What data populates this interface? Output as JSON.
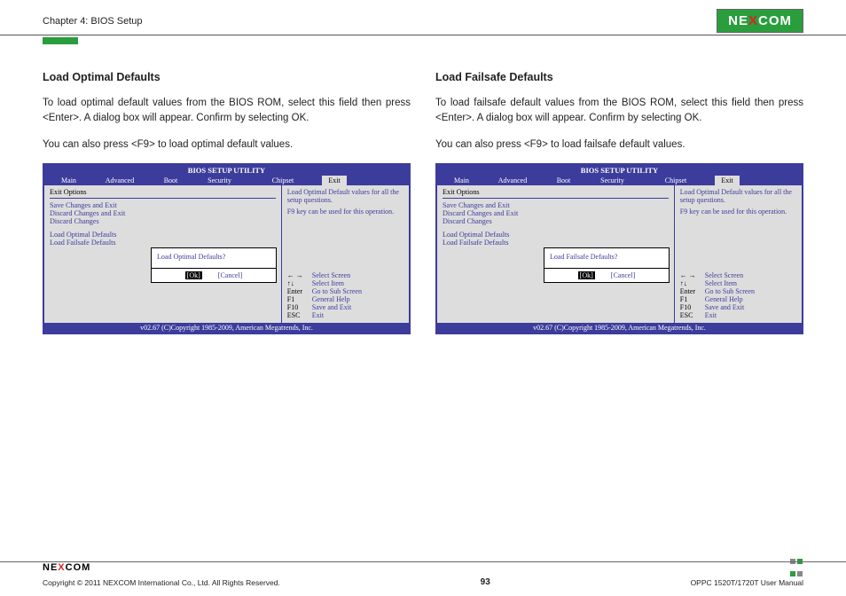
{
  "header": {
    "chapter": "Chapter 4: BIOS Setup",
    "logo_pre": "NE",
    "logo_x": "X",
    "logo_post": "COM"
  },
  "left": {
    "title": "Load Optimal Defaults",
    "para1": "To load optimal default values from the BIOS ROM, select this field then press <Enter>. A dialog box will appear. Confirm by selecting OK.",
    "para2": "You can also press <F9> to load optimal default values.",
    "dialog_title": "Load Optimal Defaults?"
  },
  "right": {
    "title": "Load Failsafe Defaults",
    "para1": "To load failsafe default values from the BIOS ROM, select this field then press <Enter>. A dialog box will appear. Confirm by selecting OK.",
    "para2": "You can also press <F9> to load failsafe default values.",
    "dialog_title": "Load Failsafe Defaults?"
  },
  "bios": {
    "utility_title": "BIOS SETUP UTILITY",
    "menu": {
      "main": "Main",
      "advanced": "Advanced",
      "boot": "Boot",
      "security": "Security",
      "chipset": "Chipset",
      "exit": "Exit"
    },
    "exit_header": "Exit Options",
    "items": {
      "save": "Save Changes and Exit",
      "discard_exit": "Discard Changes and Exit",
      "discard": "Discard Changes",
      "load_opt": "Load Optimal Defaults",
      "load_fail": "Load Failsafe Defaults"
    },
    "help1": "Load Optimal Default values for all the setup questions.",
    "help2": "F9 key can be used for this operation.",
    "nav": [
      {
        "k": "← →",
        "v": "Select Screen"
      },
      {
        "k": "↑↓",
        "v": "Select Item"
      },
      {
        "k": "Enter",
        "v": "Go to Sub Screen"
      },
      {
        "k": "F1",
        "v": "General Help"
      },
      {
        "k": "F10",
        "v": "Save and Exit"
      },
      {
        "k": "ESC",
        "v": "Exit"
      }
    ],
    "dialog_ok": "[Ok]",
    "dialog_cancel": "[Cancel]",
    "copyright": "v02.67 (C)Copyright 1985-2009, American Megatrends, Inc."
  },
  "footer": {
    "copyright": "Copyright © 2011 NEXCOM International Co., Ltd. All Rights Reserved.",
    "page": "93",
    "manual": "OPPC 1520T/1720T User Manual"
  }
}
